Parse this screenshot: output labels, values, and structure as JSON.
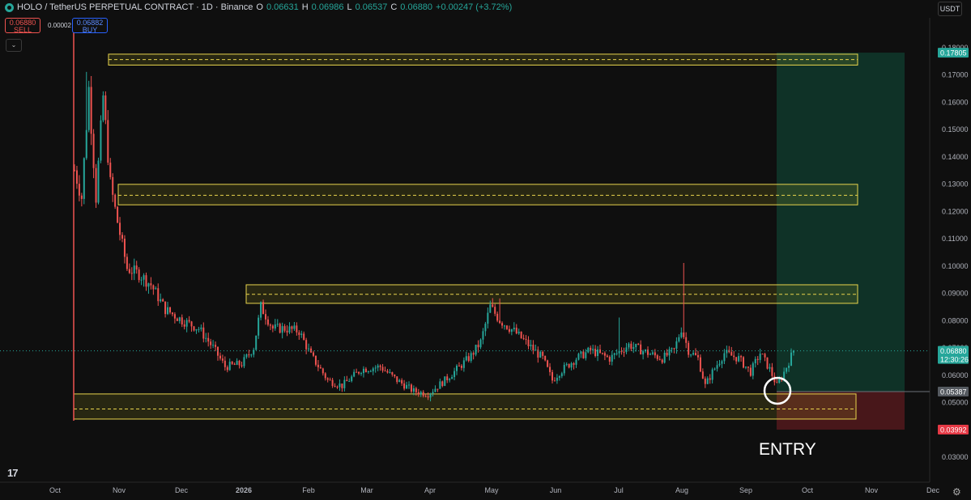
{
  "header": {
    "symbol": "HOLO / TetherUS PERPETUAL CONTRACT · 1D · Binance",
    "open_label": "O",
    "open": "0.06631",
    "high_label": "H",
    "high": "0.06986",
    "low_label": "L",
    "low": "0.06537",
    "close_label": "C",
    "close": "0.06880",
    "change": "+0.00247 (+3.72%)"
  },
  "trade": {
    "sell_price": "0.06880",
    "sell_label": "SELL",
    "buy_price": "0.06882",
    "buy_label": "BUY",
    "spread": "0.00002"
  },
  "currency": "USDT",
  "annotation": "ENTRY",
  "colors": {
    "up": "#26a69a",
    "down": "#ef5350",
    "zone_border": "#e8d44d",
    "zone_fill": "rgba(200,190,40,0.14)",
    "target_fill": "rgba(16,80,60,0.55)",
    "stop_fill": "rgba(110,28,34,0.6)",
    "background": "#0f0f0f"
  },
  "chart_data": {
    "type": "candlestick",
    "interval": "1D",
    "ylim": [
      0.025,
      0.182
    ],
    "y_ticks": [
      "0.18000",
      "0.17000",
      "0.16000",
      "0.15000",
      "0.14000",
      "0.13000",
      "0.12000",
      "0.11000",
      "0.10000",
      "0.09000",
      "0.08000",
      "0.07000",
      "0.06000",
      "0.05000",
      "0.04000",
      "0.03000"
    ],
    "x_ticks": [
      "Oct",
      "Nov",
      "Dec",
      "2026",
      "Feb",
      "Mar",
      "Apr",
      "May",
      "Jun",
      "Jul",
      "Aug",
      "Sep",
      "Oct",
      "Nov",
      "Dec"
    ],
    "price_key_points": [
      {
        "t": 0,
        "p": 0.135
      },
      {
        "t": 3,
        "p": 0.125
      },
      {
        "t": 6,
        "p": 0.165
      },
      {
        "t": 9,
        "p": 0.125
      },
      {
        "t": 12,
        "p": 0.162
      },
      {
        "t": 15,
        "p": 0.13
      },
      {
        "t": 18,
        "p": 0.116
      },
      {
        "t": 22,
        "p": 0.099
      },
      {
        "t": 27,
        "p": 0.097
      },
      {
        "t": 32,
        "p": 0.093
      },
      {
        "t": 38,
        "p": 0.084
      },
      {
        "t": 45,
        "p": 0.08
      },
      {
        "t": 52,
        "p": 0.077
      },
      {
        "t": 58,
        "p": 0.07
      },
      {
        "t": 63,
        "p": 0.063
      },
      {
        "t": 70,
        "p": 0.064
      },
      {
        "t": 75,
        "p": 0.07
      },
      {
        "t": 78,
        "p": 0.085
      },
      {
        "t": 83,
        "p": 0.077
      },
      {
        "t": 88,
        "p": 0.077
      },
      {
        "t": 94,
        "p": 0.076
      },
      {
        "t": 99,
        "p": 0.067
      },
      {
        "t": 103,
        "p": 0.062
      },
      {
        "t": 106,
        "p": 0.058
      },
      {
        "t": 112,
        "p": 0.056
      },
      {
        "t": 120,
        "p": 0.062
      },
      {
        "t": 128,
        "p": 0.063
      },
      {
        "t": 135,
        "p": 0.058
      },
      {
        "t": 142,
        "p": 0.054
      },
      {
        "t": 148,
        "p": 0.053
      },
      {
        "t": 155,
        "p": 0.058
      },
      {
        "t": 160,
        "p": 0.062
      },
      {
        "t": 166,
        "p": 0.067
      },
      {
        "t": 170,
        "p": 0.072
      },
      {
        "t": 174,
        "p": 0.085
      },
      {
        "t": 178,
        "p": 0.08
      },
      {
        "t": 184,
        "p": 0.076
      },
      {
        "t": 190,
        "p": 0.071
      },
      {
        "t": 196,
        "p": 0.066
      },
      {
        "t": 200,
        "p": 0.058
      },
      {
        "t": 203,
        "p": 0.061
      },
      {
        "t": 210,
        "p": 0.066
      },
      {
        "t": 216,
        "p": 0.069
      },
      {
        "t": 224,
        "p": 0.066
      },
      {
        "t": 232,
        "p": 0.071
      },
      {
        "t": 240,
        "p": 0.068
      },
      {
        "t": 246,
        "p": 0.066
      },
      {
        "t": 251,
        "p": 0.069
      },
      {
        "t": 254,
        "p": 0.077
      },
      {
        "t": 257,
        "p": 0.069
      },
      {
        "t": 261,
        "p": 0.066
      },
      {
        "t": 264,
        "p": 0.056
      },
      {
        "t": 267,
        "p": 0.061
      },
      {
        "t": 272,
        "p": 0.068
      },
      {
        "t": 278,
        "p": 0.066
      },
      {
        "t": 283,
        "p": 0.061
      },
      {
        "t": 287,
        "p": 0.068
      },
      {
        "t": 291,
        "p": 0.062
      },
      {
        "t": 294,
        "p": 0.056
      },
      {
        "t": 297,
        "p": 0.061
      },
      {
        "t": 301,
        "p": 0.0688
      }
    ],
    "notable_wicks": [
      {
        "t": 5,
        "high": 0.171
      },
      {
        "t": 255,
        "high": 0.101
      },
      {
        "t": 228,
        "high": 0.081
      },
      {
        "t": 178,
        "high": 0.088
      }
    ],
    "zones": [
      {
        "top": 0.1775,
        "bottom": 0.1735,
        "mid": 0.1755
      },
      {
        "top": 0.1298,
        "bottom": 0.1223,
        "mid": 0.1258
      },
      {
        "top": 0.093,
        "bottom": 0.0862,
        "mid": 0.0895
      },
      {
        "top": 0.053,
        "bottom": 0.0438,
        "mid": 0.0475
      }
    ],
    "position": {
      "target": 0.17805,
      "entry": 0.05387,
      "stop": 0.03992
    },
    "price_labels": [
      {
        "value": 0.17805,
        "text": "0.17805",
        "color": "#26a69a"
      },
      {
        "value": 0.0688,
        "text": "0.06880",
        "sub": "12:30:26",
        "color": "#26a69a"
      },
      {
        "value": 0.05387,
        "text": "0.05387",
        "color": "#555a60"
      },
      {
        "value": 0.03992,
        "text": "0.03992",
        "color": "#e53945"
      }
    ]
  }
}
